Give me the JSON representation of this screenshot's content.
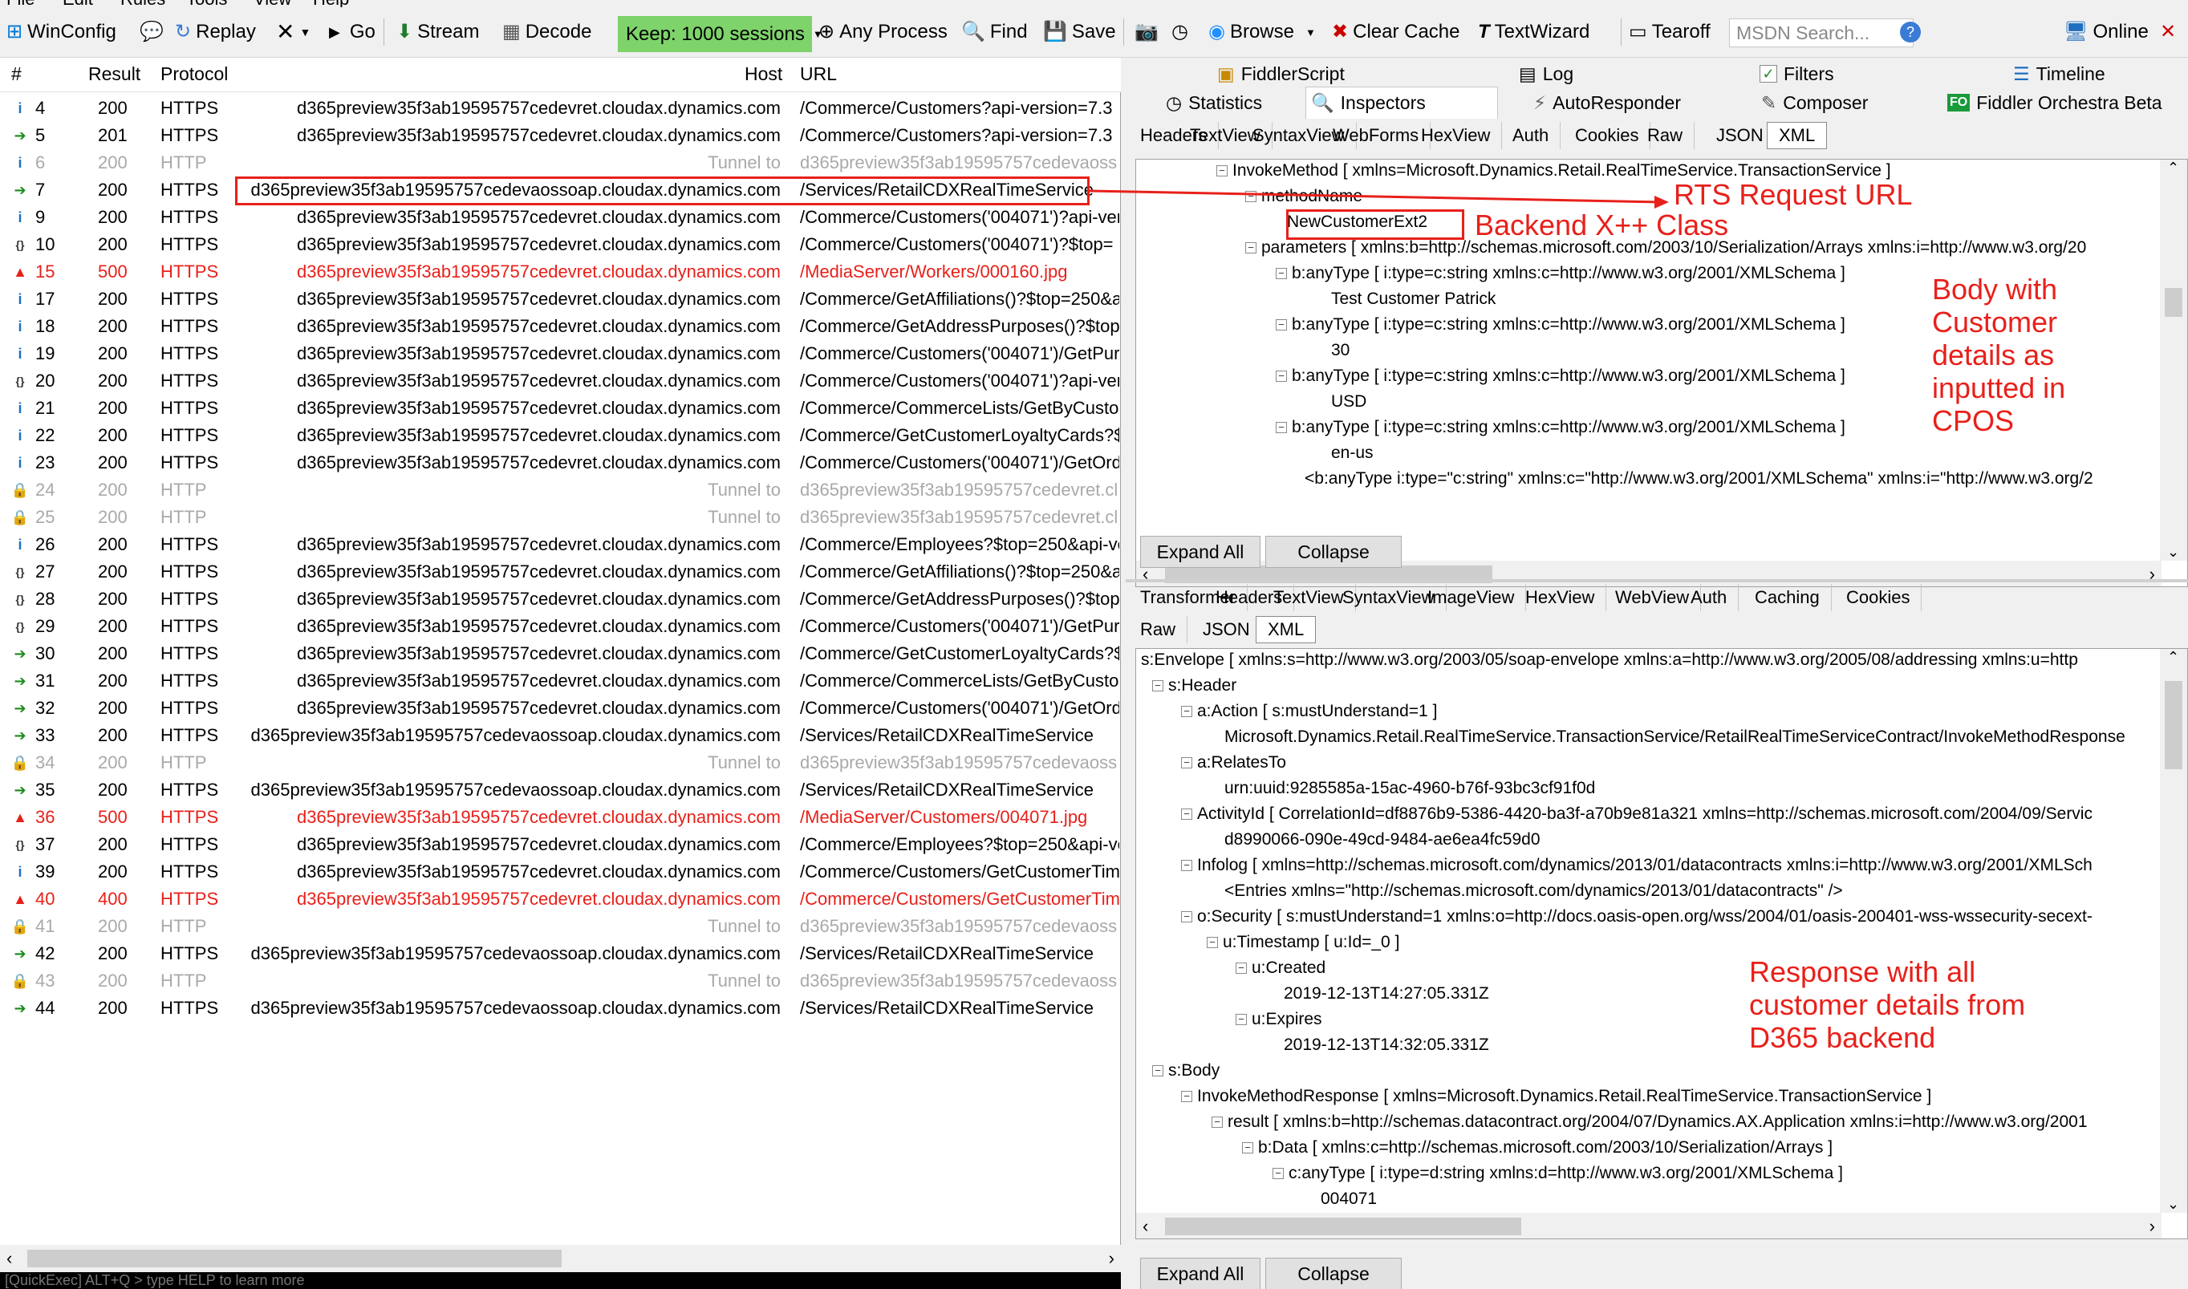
{
  "menu": [
    "File",
    "Edit",
    "Rules",
    "Tools",
    "View",
    "Help"
  ],
  "toolbar": {
    "winconfig": "WinConfig",
    "replay": "Replay",
    "go": "Go",
    "stream": "Stream",
    "decode": "Decode",
    "keep": "Keep: 1000 sessions",
    "any_process": "Any Process",
    "find": "Find",
    "save": "Save",
    "browse": "Browse",
    "clear_cache": "Clear Cache",
    "textwizard": "TextWizard",
    "tearoff": "Tearoff",
    "msdn_placeholder": "MSDN Search...",
    "online": "Online"
  },
  "sessions": {
    "columns": {
      "num": "#",
      "result": "Result",
      "protocol": "Protocol",
      "host": "Host",
      "url": "URL"
    },
    "rows": [
      {
        "icon": "info",
        "num": "4",
        "result": "200",
        "protocol": "HTTPS",
        "host": "d365preview35f3ab19595757cedevret.cloudax.dynamics.com",
        "url": "/Commerce/Customers?api-version=7.3",
        "style": "normal"
      },
      {
        "icon": "post",
        "num": "5",
        "result": "201",
        "protocol": "HTTPS",
        "host": "d365preview35f3ab19595757cedevret.cloudax.dynamics.com",
        "url": "/Commerce/Customers?api-version=7.3",
        "style": "normal"
      },
      {
        "icon": "info",
        "num": "6",
        "result": "200",
        "protocol": "HTTP",
        "host": "Tunnel to",
        "url": "d365preview35f3ab19595757cedevaoss",
        "style": "gray"
      },
      {
        "icon": "post",
        "num": "7",
        "result": "200",
        "protocol": "HTTPS",
        "host": "d365preview35f3ab19595757cedevaossoap.cloudax.dynamics.com",
        "url": "/Services/RetailCDXRealTimeService",
        "style": "selected"
      },
      {
        "icon": "info",
        "num": "9",
        "result": "200",
        "protocol": "HTTPS",
        "host": "d365preview35f3ab19595757cedevret.cloudax.dynamics.com",
        "url": "/Commerce/Customers('004071')?api-vers",
        "style": "normal"
      },
      {
        "icon": "json",
        "num": "10",
        "result": "200",
        "protocol": "HTTPS",
        "host": "d365preview35f3ab19595757cedevret.cloudax.dynamics.com",
        "url": "/Commerce/Customers('004071')?$top=",
        "style": "normal"
      },
      {
        "icon": "error",
        "num": "15",
        "result": "500",
        "protocol": "HTTPS",
        "host": "d365preview35f3ab19595757cedevret.cloudax.dynamics.com",
        "url": "/MediaServer/Workers/000160.jpg",
        "style": "red"
      },
      {
        "icon": "info",
        "num": "17",
        "result": "200",
        "protocol": "HTTPS",
        "host": "d365preview35f3ab19595757cedevret.cloudax.dynamics.com",
        "url": "/Commerce/GetAffiliations()?$top=250&a",
        "style": "normal"
      },
      {
        "icon": "info",
        "num": "18",
        "result": "200",
        "protocol": "HTTPS",
        "host": "d365preview35f3ab19595757cedevret.cloudax.dynamics.com",
        "url": "/Commerce/GetAddressPurposes()?$top=",
        "style": "normal"
      },
      {
        "icon": "info",
        "num": "19",
        "result": "200",
        "protocol": "HTTPS",
        "host": "d365preview35f3ab19595757cedevret.cloudax.dynamics.com",
        "url": "/Commerce/Customers('004071')/GetPurc",
        "style": "normal"
      },
      {
        "icon": "json",
        "num": "20",
        "result": "200",
        "protocol": "HTTPS",
        "host": "d365preview35f3ab19595757cedevret.cloudax.dynamics.com",
        "url": "/Commerce/Customers('004071')?api-vers",
        "style": "normal"
      },
      {
        "icon": "info",
        "num": "21",
        "result": "200",
        "protocol": "HTTPS",
        "host": "d365preview35f3ab19595757cedevret.cloudax.dynamics.com",
        "url": "/Commerce/CommerceLists/GetByCustom",
        "style": "normal"
      },
      {
        "icon": "info",
        "num": "22",
        "result": "200",
        "protocol": "HTTPS",
        "host": "d365preview35f3ab19595757cedevret.cloudax.dynamics.com",
        "url": "/Commerce/GetCustomerLoyaltyCards?$t",
        "style": "normal"
      },
      {
        "icon": "info",
        "num": "23",
        "result": "200",
        "protocol": "HTTPS",
        "host": "d365preview35f3ab19595757cedevret.cloudax.dynamics.com",
        "url": "/Commerce/Customers('004071')/GetOrde",
        "style": "normal"
      },
      {
        "icon": "lock",
        "num": "24",
        "result": "200",
        "protocol": "HTTP",
        "host": "Tunnel to",
        "url": "d365preview35f3ab19595757cedevret.cl",
        "style": "gray"
      },
      {
        "icon": "lock",
        "num": "25",
        "result": "200",
        "protocol": "HTTP",
        "host": "Tunnel to",
        "url": "d365preview35f3ab19595757cedevret.cl",
        "style": "gray"
      },
      {
        "icon": "info",
        "num": "26",
        "result": "200",
        "protocol": "HTTPS",
        "host": "d365preview35f3ab19595757cedevret.cloudax.dynamics.com",
        "url": "/Commerce/Employees?$top=250&api-ve",
        "style": "normal"
      },
      {
        "icon": "json",
        "num": "27",
        "result": "200",
        "protocol": "HTTPS",
        "host": "d365preview35f3ab19595757cedevret.cloudax.dynamics.com",
        "url": "/Commerce/GetAffiliations()?$top=250&a",
        "style": "normal"
      },
      {
        "icon": "json",
        "num": "28",
        "result": "200",
        "protocol": "HTTPS",
        "host": "d365preview35f3ab19595757cedevret.cloudax.dynamics.com",
        "url": "/Commerce/GetAddressPurposes()?$top=",
        "style": "normal"
      },
      {
        "icon": "json",
        "num": "29",
        "result": "200",
        "protocol": "HTTPS",
        "host": "d365preview35f3ab19595757cedevret.cloudax.dynamics.com",
        "url": "/Commerce/Customers('004071')/GetPurc",
        "style": "normal"
      },
      {
        "icon": "post",
        "num": "30",
        "result": "200",
        "protocol": "HTTPS",
        "host": "d365preview35f3ab19595757cedevret.cloudax.dynamics.com",
        "url": "/Commerce/GetCustomerLoyaltyCards?$t",
        "style": "normal"
      },
      {
        "icon": "post",
        "num": "31",
        "result": "200",
        "protocol": "HTTPS",
        "host": "d365preview35f3ab19595757cedevret.cloudax.dynamics.com",
        "url": "/Commerce/CommerceLists/GetByCustom",
        "style": "normal"
      },
      {
        "icon": "post",
        "num": "32",
        "result": "200",
        "protocol": "HTTPS",
        "host": "d365preview35f3ab19595757cedevret.cloudax.dynamics.com",
        "url": "/Commerce/Customers('004071')/GetOrde",
        "style": "normal"
      },
      {
        "icon": "post",
        "num": "33",
        "result": "200",
        "protocol": "HTTPS",
        "host": "d365preview35f3ab19595757cedevaossoap.cloudax.dynamics.com",
        "url": "/Services/RetailCDXRealTimeService",
        "style": "normal"
      },
      {
        "icon": "lock",
        "num": "34",
        "result": "200",
        "protocol": "HTTP",
        "host": "Tunnel to",
        "url": "d365preview35f3ab19595757cedevaoss",
        "style": "gray"
      },
      {
        "icon": "post",
        "num": "35",
        "result": "200",
        "protocol": "HTTPS",
        "host": "d365preview35f3ab19595757cedevaossoap.cloudax.dynamics.com",
        "url": "/Services/RetailCDXRealTimeService",
        "style": "normal"
      },
      {
        "icon": "error",
        "num": "36",
        "result": "500",
        "protocol": "HTTPS",
        "host": "d365preview35f3ab19595757cedevret.cloudax.dynamics.com",
        "url": "/MediaServer/Customers/004071.jpg",
        "style": "red"
      },
      {
        "icon": "json",
        "num": "37",
        "result": "200",
        "protocol": "HTTPS",
        "host": "d365preview35f3ab19595757cedevret.cloudax.dynamics.com",
        "url": "/Commerce/Employees?$top=250&api-ve",
        "style": "normal"
      },
      {
        "icon": "info",
        "num": "39",
        "result": "200",
        "protocol": "HTTPS",
        "host": "d365preview35f3ab19595757cedevret.cloudax.dynamics.com",
        "url": "/Commerce/Customers/GetCustomerTime",
        "style": "normal"
      },
      {
        "icon": "error",
        "num": "40",
        "result": "400",
        "protocol": "HTTPS",
        "host": "d365preview35f3ab19595757cedevret.cloudax.dynamics.com",
        "url": "/Commerce/Customers/GetCustomerTime",
        "style": "red"
      },
      {
        "icon": "lock",
        "num": "41",
        "result": "200",
        "protocol": "HTTP",
        "host": "Tunnel to",
        "url": "d365preview35f3ab19595757cedevaoss",
        "style": "gray"
      },
      {
        "icon": "post",
        "num": "42",
        "result": "200",
        "protocol": "HTTPS",
        "host": "d365preview35f3ab19595757cedevaossoap.cloudax.dynamics.com",
        "url": "/Services/RetailCDXRealTimeService",
        "style": "normal"
      },
      {
        "icon": "lock",
        "num": "43",
        "result": "200",
        "protocol": "HTTP",
        "host": "Tunnel to",
        "url": "d365preview35f3ab19595757cedevaoss",
        "style": "gray"
      },
      {
        "icon": "post",
        "num": "44",
        "result": "200",
        "protocol": "HTTPS",
        "host": "d365preview35f3ab19595757cedevaossoap.cloudax.dynamics.com",
        "url": "/Services/RetailCDXRealTimeService",
        "style": "normal"
      }
    ],
    "quickexec": "[QuickExec] ALT+Q > type HELP to learn more"
  },
  "top_tabs": {
    "row1": [
      "FiddlerScript",
      "Log",
      "Filters",
      "Timeline"
    ],
    "row2": [
      "Statistics",
      "Inspectors",
      "AutoResponder",
      "Composer",
      "Fiddler Orchestra Beta"
    ]
  },
  "request": {
    "tabs": [
      "Headers",
      "TextView",
      "SyntaxView",
      "WebForms",
      "HexView",
      "Auth",
      "Cookies",
      "Raw",
      "JSON",
      "XML"
    ],
    "tree": [
      "InvokeMethod [ xmlns=Microsoft.Dynamics.Retail.RealTimeService.TransactionService ]",
      "methodName",
      "NewCustomerExt2",
      "parameters [ xmlns:b=http://schemas.microsoft.com/2003/10/Serialization/Arrays xmlns:i=http://www.w3.org/20",
      "b:anyType [ i:type=c:string xmlns:c=http://www.w3.org/2001/XMLSchema ]",
      "Test Customer Patrick",
      "b:anyType [ i:type=c:string xmlns:c=http://www.w3.org/2001/XMLSchema ]",
      "30",
      "b:anyType [ i:type=c:string xmlns:c=http://www.w3.org/2001/XMLSchema ]",
      "USD",
      "b:anyType [ i:type=c:string xmlns:c=http://www.w3.org/2001/XMLSchema ]",
      "en-us",
      "<b:anyType i:type=\"c:string\" xmlns:c=\"http://www.w3.org/2001/XMLSchema\" xmlns:i=\"http://www.w3.org/2"
    ],
    "expand_all": "Expand All",
    "collapse": "Collapse"
  },
  "response": {
    "tabs": [
      "Transformer",
      "Headers",
      "TextView",
      "SyntaxView",
      "ImageView",
      "HexView",
      "WebView",
      "Auth",
      "Caching",
      "Cookies"
    ],
    "tabs2": [
      "Raw",
      "JSON",
      "XML"
    ],
    "tree": [
      "s:Envelope [ xmlns:s=http://www.w3.org/2003/05/soap-envelope xmlns:a=http://www.w3.org/2005/08/addressing xmlns:u=http",
      "s:Header",
      "a:Action [ s:mustUnderstand=1 ]",
      "Microsoft.Dynamics.Retail.RealTimeService.TransactionService/RetailRealTimeServiceContract/InvokeMethodResponse",
      "a:RelatesTo",
      "urn:uuid:9285585a-15ac-4960-b76f-93bc3cf91f0d",
      "ActivityId [ CorrelationId=df8876b9-5386-4420-ba3f-a70b9e81a321 xmlns=http://schemas.microsoft.com/2004/09/Servic",
      "d8990066-090e-49cd-9484-ae6ea4fc59d0",
      "Infolog [ xmlns=http://schemas.microsoft.com/dynamics/2013/01/datacontracts xmlns:i=http://www.w3.org/2001/XMLSch",
      "<Entries xmlns=\"http://schemas.microsoft.com/dynamics/2013/01/datacontracts\" />",
      "o:Security [ s:mustUnderstand=1 xmlns:o=http://docs.oasis-open.org/wss/2004/01/oasis-200401-wss-wssecurity-secext-",
      "u:Timestamp [ u:Id=_0 ]",
      "u:Created",
      "2019-12-13T14:27:05.331Z",
      "u:Expires",
      "2019-12-13T14:32:05.331Z",
      "s:Body",
      "InvokeMethodResponse [ xmlns=Microsoft.Dynamics.Retail.RealTimeService.TransactionService ]",
      "result [ xmlns:b=http://schemas.datacontract.org/2004/07/Dynamics.AX.Application xmlns:i=http://www.w3.org/2001",
      "b:Data [ xmlns:c=http://schemas.microsoft.com/2003/10/Serialization/Arrays ]",
      "c:anyType [ i:type=d:string xmlns:d=http://www.w3.org/2001/XMLSchema ]",
      "004071"
    ],
    "expand_all": "Expand All",
    "collapse": "Collapse"
  },
  "annotations": {
    "rts_url": "RTS Request URL",
    "backend_class": "Backend X++ Class",
    "body": [
      "Body with",
      "Customer",
      "details as",
      "inputted in",
      "CPOS"
    ],
    "response": [
      "Response with all",
      "customer details from",
      "D365 backend"
    ]
  },
  "colors": {
    "accent_red": "#e8201a",
    "keep_green": "#7ed36b",
    "gray_text": "#a9a9a9"
  }
}
